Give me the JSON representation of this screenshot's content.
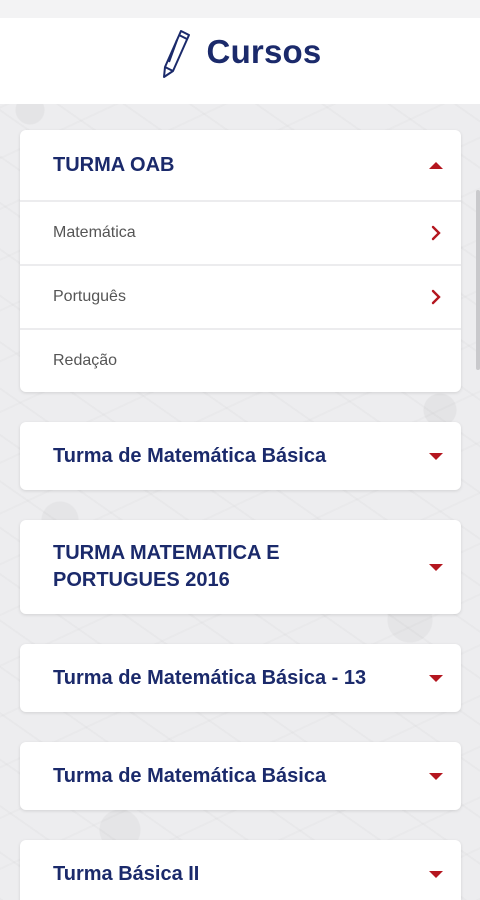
{
  "header": {
    "title": "Cursos",
    "icon": "pencil-icon"
  },
  "expanded_course": {
    "title": "TURMA OAB",
    "subjects": [
      {
        "label": "Matemática",
        "has_arrow": true
      },
      {
        "label": "Português",
        "has_arrow": true
      },
      {
        "label": "Redação",
        "has_arrow": false
      }
    ]
  },
  "courses": [
    {
      "title": "Turma de Matemática Básica"
    },
    {
      "title": "TURMA MATEMATICA E PORTUGUES 2016"
    },
    {
      "title": "Turma de Matemática Básica - 13"
    },
    {
      "title": "Turma de Matemática Básica"
    },
    {
      "title": "Turma Básica II"
    }
  ],
  "colors": {
    "brand": "#1b2a6b",
    "accent": "#b4161f"
  }
}
